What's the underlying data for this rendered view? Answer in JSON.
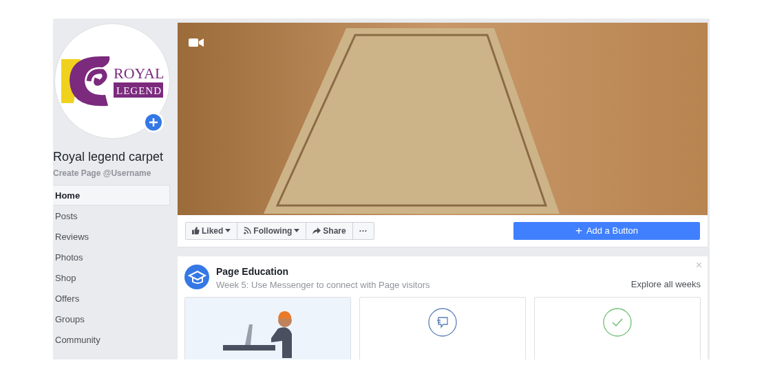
{
  "profile": {
    "logo_line_1": "ROYAL",
    "logo_line_2": "LEGEND",
    "name": "Royal legend carpet",
    "username_link": "Create Page @Username"
  },
  "sidebar": {
    "items": [
      {
        "label": "Home",
        "selected": true
      },
      {
        "label": "Posts",
        "selected": false
      },
      {
        "label": "Reviews",
        "selected": false
      },
      {
        "label": "Photos",
        "selected": false
      },
      {
        "label": "Shop",
        "selected": false
      },
      {
        "label": "Offers",
        "selected": false
      },
      {
        "label": "Groups",
        "selected": false
      },
      {
        "label": "Community",
        "selected": false
      }
    ]
  },
  "actions": {
    "buttons": [
      {
        "kind": "like",
        "label": "Liked",
        "dropdown": true
      },
      {
        "kind": "follow",
        "label": "Following",
        "dropdown": true
      },
      {
        "kind": "share",
        "label": "Share",
        "dropdown": false
      },
      {
        "kind": "more",
        "label": "···",
        "dropdown": false
      }
    ],
    "primary": {
      "icon": "+",
      "label": "Add a Button"
    }
  },
  "education": {
    "title": "Page Education",
    "subtitle": "Week 5: Use Messenger to connect with Page visitors",
    "link": "Explore all weeks",
    "close": "×",
    "cards": [
      {
        "kind": "illustration"
      },
      {
        "kind": "chat"
      },
      {
        "kind": "check"
      }
    ]
  }
}
